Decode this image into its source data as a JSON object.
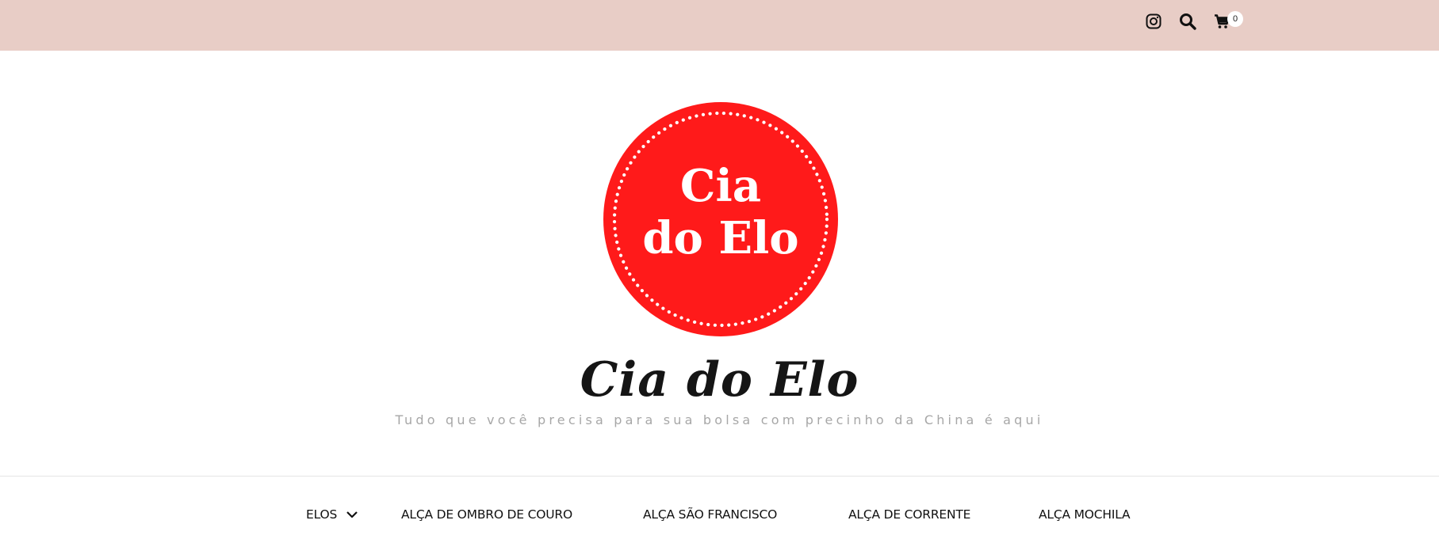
{
  "header": {
    "icons": {
      "instagram": "instagram-icon",
      "search": "search-icon",
      "cart": "cart-icon"
    },
    "cart_count": "0",
    "background_color": "#e8cdc6"
  },
  "logo": {
    "text_line1": "Cia",
    "text_line2": "do Elo",
    "color": "#ff1a1a"
  },
  "site": {
    "title": "Cia do Elo",
    "tagline": "Tudo que você precisa para sua bolsa com precinho da China é aqui"
  },
  "nav": {
    "items": [
      {
        "label": "ELOS",
        "has_dropdown": true
      },
      {
        "label": "ALÇA DE OMBRO DE COURO"
      },
      {
        "label": "ALÇA SÃO FRANCISCO"
      },
      {
        "label": "ALÇA DE CORRENTE"
      },
      {
        "label": "ALÇA MOCHILA"
      }
    ]
  }
}
